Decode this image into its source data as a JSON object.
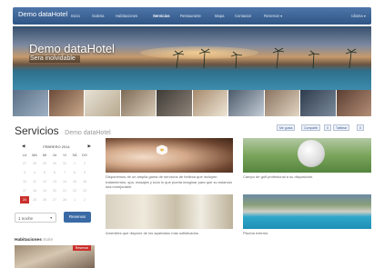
{
  "nav": {
    "brand": "Demo dataHotel",
    "items": [
      {
        "label": "Inicio"
      },
      {
        "label": "Galeria"
      },
      {
        "label": "Habitaciones"
      },
      {
        "label": "Servicios",
        "active": true
      },
      {
        "label": "Restaurante"
      },
      {
        "label": "Mapa"
      },
      {
        "label": "Contactar"
      },
      {
        "label": "Reservar ▾"
      }
    ],
    "language": "Idioma ▾"
  },
  "hero": {
    "title": "Demo dataHotel",
    "subtitle": "Sera inolvidable"
  },
  "page": {
    "title": "Servicios",
    "subtitle": "Demo dataHotel"
  },
  "social": {
    "facebook": "Me gusta",
    "share": "Compartir",
    "share_count": "0",
    "twitter": "Twittear",
    "twitter_count": "0"
  },
  "calendar": {
    "prev": "◀",
    "next": "▶",
    "month": "FEBRERO 2014",
    "weekdays": [
      "LU",
      "MA",
      "MI",
      "JU",
      "VI",
      "SÁ",
      "DO"
    ],
    "selected_day": "24",
    "weeks": [
      [
        "27",
        "28",
        "29",
        "30",
        "31",
        "1",
        "2"
      ],
      [
        "3",
        "4",
        "5",
        "6",
        "7",
        "8",
        "9"
      ],
      [
        "10",
        "11",
        "12",
        "13",
        "14",
        "15",
        "16"
      ],
      [
        "17",
        "18",
        "19",
        "20",
        "21",
        "22",
        "23"
      ],
      [
        "24",
        "25",
        "26",
        "27",
        "28",
        "1",
        "2"
      ]
    ]
  },
  "booking": {
    "nights": "1 noche",
    "reserve": "Reservar"
  },
  "rooms": {
    "title": "Habitaciones",
    "subtitle": "Suite",
    "badge": "Reservar"
  },
  "services": [
    {
      "description": "Disponemos de un amplia gama de servicios de belleza que incluyen tratamientos, spa, masajes y todo lo que pueda imaginar para que su estancia sea inmejorable."
    },
    {
      "description": "Campo de golf profesional a su disposición."
    },
    {
      "description": "Amenities que dispone de los apartados más sofisticados."
    },
    {
      "description": "Piscina exterior."
    }
  ]
}
